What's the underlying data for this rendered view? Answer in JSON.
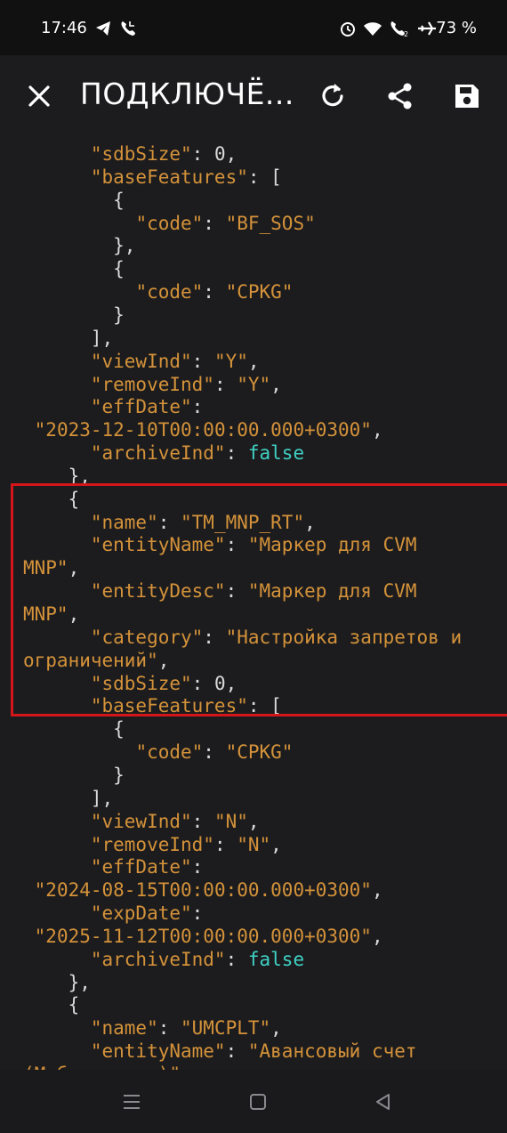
{
  "status_bar": {
    "time": "17:46",
    "battery": "73 %",
    "icons": [
      "telegram-icon",
      "call-icon",
      "alarm-icon",
      "wifi-call-icon",
      "wifi2-call-icon",
      "airplane-icon"
    ]
  },
  "toolbar": {
    "title": "ПОДКЛЮЧЁ...",
    "icons": [
      "close-icon",
      "refresh-icon",
      "share-icon",
      "save-icon"
    ]
  },
  "colors": {
    "key": "#d4923a",
    "string": "#d4923a",
    "punct": "#d9d9d9",
    "bool": "#3fd1c4",
    "highlight": "#d4161b",
    "background": "#1c1c1e"
  },
  "code_lines": [
    [
      {
        "t": "      "
      },
      {
        "k": "key",
        "t": "\"sdbSize\""
      },
      {
        "k": "punct",
        "t": ": 0,"
      }
    ],
    [
      {
        "t": "      "
      },
      {
        "k": "key",
        "t": "\"baseFeatures\""
      },
      {
        "k": "punct",
        "t": ": ["
      }
    ],
    [
      {
        "t": "        "
      },
      {
        "k": "punct",
        "t": "{"
      }
    ],
    [
      {
        "t": "          "
      },
      {
        "k": "key",
        "t": "\"code\""
      },
      {
        "k": "punct",
        "t": ": "
      },
      {
        "k": "str",
        "t": "\"BF_SOS\""
      }
    ],
    [
      {
        "t": "        "
      },
      {
        "k": "punct",
        "t": "},"
      }
    ],
    [
      {
        "t": "        "
      },
      {
        "k": "punct",
        "t": "{"
      }
    ],
    [
      {
        "t": "          "
      },
      {
        "k": "key",
        "t": "\"code\""
      },
      {
        "k": "punct",
        "t": ": "
      },
      {
        "k": "str",
        "t": "\"CPKG\""
      }
    ],
    [
      {
        "t": "        "
      },
      {
        "k": "punct",
        "t": "}"
      }
    ],
    [
      {
        "t": "      "
      },
      {
        "k": "punct",
        "t": "],"
      }
    ],
    [
      {
        "t": "      "
      },
      {
        "k": "key",
        "t": "\"viewInd\""
      },
      {
        "k": "punct",
        "t": ": "
      },
      {
        "k": "str",
        "t": "\"Y\""
      },
      {
        "k": "punct",
        "t": ","
      }
    ],
    [
      {
        "t": "      "
      },
      {
        "k": "key",
        "t": "\"removeInd\""
      },
      {
        "k": "punct",
        "t": ": "
      },
      {
        "k": "str",
        "t": "\"Y\""
      },
      {
        "k": "punct",
        "t": ","
      }
    ],
    [
      {
        "t": "      "
      },
      {
        "k": "key",
        "t": "\"effDate\""
      },
      {
        "k": "punct",
        "t": ":"
      }
    ],
    [
      {
        "t": " "
      },
      {
        "k": "str",
        "t": "\"2023-12-10T00:00:00.000+0300\""
      },
      {
        "k": "punct",
        "t": ","
      }
    ],
    [
      {
        "t": "      "
      },
      {
        "k": "key",
        "t": "\"archiveInd\""
      },
      {
        "k": "punct",
        "t": ": "
      },
      {
        "k": "bool",
        "t": "false"
      }
    ],
    [
      {
        "t": "    "
      },
      {
        "k": "punct",
        "t": "},"
      }
    ],
    [
      {
        "t": "    "
      },
      {
        "k": "punct",
        "t": "{"
      }
    ],
    [
      {
        "t": "      "
      },
      {
        "k": "key",
        "t": "\"name\""
      },
      {
        "k": "punct",
        "t": ": "
      },
      {
        "k": "str",
        "t": "\"TM_MNP_RT\""
      },
      {
        "k": "punct",
        "t": ","
      }
    ],
    [
      {
        "t": "      "
      },
      {
        "k": "key",
        "t": "\"entityName\""
      },
      {
        "k": "punct",
        "t": ": "
      },
      {
        "k": "str",
        "t": "\"Маркер для CVM"
      }
    ],
    [
      {
        "k": "str",
        "t": "MNP\""
      },
      {
        "k": "punct",
        "t": ","
      }
    ],
    [
      {
        "t": "      "
      },
      {
        "k": "key",
        "t": "\"entityDesc\""
      },
      {
        "k": "punct",
        "t": ": "
      },
      {
        "k": "str",
        "t": "\"Маркер для CVM"
      }
    ],
    [
      {
        "k": "str",
        "t": "MNP\""
      },
      {
        "k": "punct",
        "t": ","
      }
    ],
    [
      {
        "t": "      "
      },
      {
        "k": "key",
        "t": "\"category\""
      },
      {
        "k": "punct",
        "t": ": "
      },
      {
        "k": "str",
        "t": "\"Настройка запретов и"
      }
    ],
    [
      {
        "k": "str",
        "t": "ограничений\""
      },
      {
        "k": "punct",
        "t": ","
      }
    ],
    [
      {
        "t": "      "
      },
      {
        "k": "key",
        "t": "\"sdbSize\""
      },
      {
        "k": "punct",
        "t": ": 0,"
      }
    ],
    [
      {
        "t": "      "
      },
      {
        "k": "key",
        "t": "\"baseFeatures\""
      },
      {
        "k": "punct",
        "t": ": ["
      }
    ],
    [
      {
        "t": "        "
      },
      {
        "k": "punct",
        "t": "{"
      }
    ],
    [
      {
        "t": "          "
      },
      {
        "k": "key",
        "t": "\"code\""
      },
      {
        "k": "punct",
        "t": ": "
      },
      {
        "k": "str",
        "t": "\"CPKG\""
      }
    ],
    [
      {
        "t": "        "
      },
      {
        "k": "punct",
        "t": "}"
      }
    ],
    [
      {
        "t": "      "
      },
      {
        "k": "punct",
        "t": "],"
      }
    ],
    [
      {
        "t": "      "
      },
      {
        "k": "key",
        "t": "\"viewInd\""
      },
      {
        "k": "punct",
        "t": ": "
      },
      {
        "k": "str",
        "t": "\"N\""
      },
      {
        "k": "punct",
        "t": ","
      }
    ],
    [
      {
        "t": "      "
      },
      {
        "k": "key",
        "t": "\"removeInd\""
      },
      {
        "k": "punct",
        "t": ": "
      },
      {
        "k": "str",
        "t": "\"N\""
      },
      {
        "k": "punct",
        "t": ","
      }
    ],
    [
      {
        "t": "      "
      },
      {
        "k": "key",
        "t": "\"effDate\""
      },
      {
        "k": "punct",
        "t": ":"
      }
    ],
    [
      {
        "t": " "
      },
      {
        "k": "str",
        "t": "\"2024-08-15T00:00:00.000+0300\""
      },
      {
        "k": "punct",
        "t": ","
      }
    ],
    [
      {
        "t": "      "
      },
      {
        "k": "key",
        "t": "\"expDate\""
      },
      {
        "k": "punct",
        "t": ":"
      }
    ],
    [
      {
        "t": " "
      },
      {
        "k": "str",
        "t": "\"2025-11-12T00:00:00.000+0300\""
      },
      {
        "k": "punct",
        "t": ","
      }
    ],
    [
      {
        "t": "      "
      },
      {
        "k": "key",
        "t": "\"archiveInd\""
      },
      {
        "k": "punct",
        "t": ": "
      },
      {
        "k": "bool",
        "t": "false"
      }
    ],
    [
      {
        "t": "    "
      },
      {
        "k": "punct",
        "t": "},"
      }
    ],
    [
      {
        "t": "    "
      },
      {
        "k": "punct",
        "t": "{"
      }
    ],
    [
      {
        "t": "      "
      },
      {
        "k": "key",
        "t": "\"name\""
      },
      {
        "k": "punct",
        "t": ": "
      },
      {
        "k": "str",
        "t": "\"UMCPLT\""
      },
      {
        "k": "punct",
        "t": ","
      }
    ],
    [
      {
        "t": "      "
      },
      {
        "k": "key",
        "t": "\"entityName\""
      },
      {
        "k": "punct",
        "t": ": "
      },
      {
        "k": "str",
        "t": "\"Авансовый счет"
      }
    ],
    [
      {
        "k": "str",
        "t": "(Моб. платеж)\""
      },
      {
        "k": "punct",
        "t": ","
      }
    ]
  ],
  "nav_bar": {
    "icons": [
      "recent-apps-icon",
      "home-icon",
      "back-icon"
    ]
  }
}
